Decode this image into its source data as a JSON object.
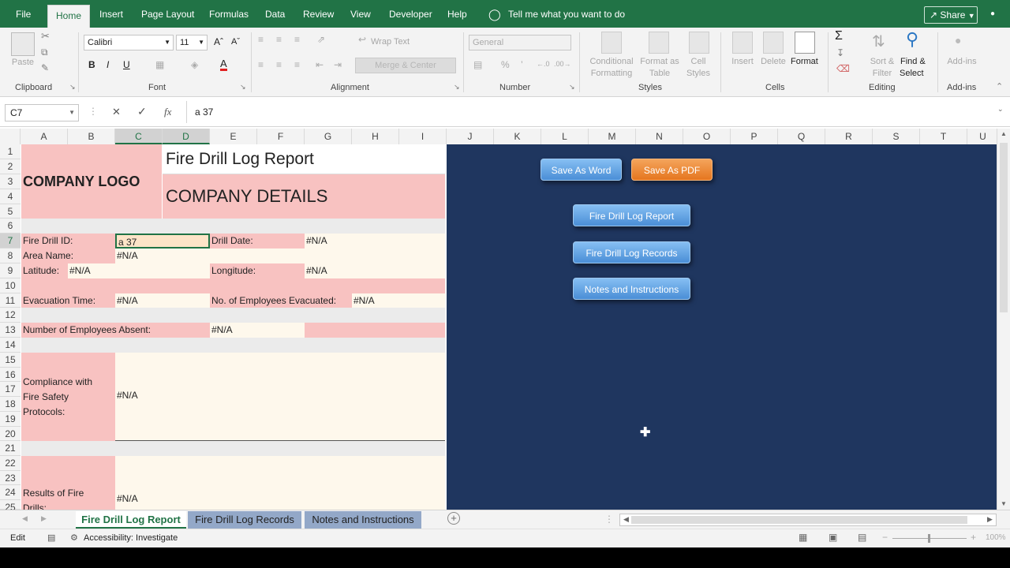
{
  "menu": {
    "tabs": [
      "File",
      "Home",
      "Insert",
      "Page Layout",
      "Formulas",
      "Data",
      "Review",
      "View",
      "Developer",
      "Help"
    ],
    "tell_me": "Tell me what you want to do",
    "share": "Share"
  },
  "ribbon": {
    "clipboard": {
      "paste": "Paste",
      "label": "Clipboard"
    },
    "font": {
      "name": "Calibri",
      "size": "11",
      "bold": "B",
      "italic": "I",
      "underline": "U",
      "label": "Font"
    },
    "alignment": {
      "wrap": "Wrap Text",
      "merge": "Merge & Center",
      "label": "Alignment"
    },
    "number": {
      "format": "General",
      "label": "Number"
    },
    "styles": {
      "conditional": [
        "Conditional",
        "Formatting"
      ],
      "format_table": [
        "Format as",
        "Table"
      ],
      "cell_styles": [
        "Cell",
        "Styles"
      ],
      "label": "Styles"
    },
    "cells": {
      "insert": "Insert",
      "delete": "Delete",
      "format": "Format",
      "label": "Cells"
    },
    "editing": {
      "sort": [
        "Sort &",
        "Filter"
      ],
      "find": [
        "Find &",
        "Select"
      ],
      "label": "Editing"
    },
    "addins": {
      "addins": "Add-ins",
      "label": "Add-ins"
    }
  },
  "formula_bar": {
    "name_box": "C7",
    "cancel": "✕",
    "enter": "✓",
    "fx": "fx",
    "formula": "a 37"
  },
  "columns": [
    "A",
    "B",
    "C",
    "D",
    "E",
    "F",
    "G",
    "H",
    "I",
    "J",
    "K",
    "L",
    "M",
    "N",
    "O",
    "P",
    "Q",
    "R",
    "S",
    "T",
    "U"
  ],
  "rows": [
    "1",
    "2",
    "3",
    "4",
    "5",
    "6",
    "7",
    "8",
    "9",
    "10",
    "11",
    "12",
    "13",
    "14",
    "15",
    "16",
    "17",
    "18",
    "19",
    "20",
    "21",
    "22",
    "23",
    "24",
    "25"
  ],
  "sheet": {
    "company_logo": "COMPANY LOGO",
    "report_title": "Fire Drill Log Report",
    "company_details": "COMPANY DETAILS",
    "fire_drill_id_label": "Fire Drill ID:",
    "fire_drill_id_value": "a 37",
    "drill_date_label": "Drill Date:",
    "drill_date_value": "#N/A",
    "area_name_label": "Area Name:",
    "area_name_value": "#N/A",
    "latitude_label": "Latitude:",
    "latitude_value": "#N/A",
    "longitude_label": "Longitude:",
    "longitude_value": "#N/A",
    "evac_time_label": "Evacuation Time:",
    "evac_time_value": "#N/A",
    "employees_evac_label": "No. of Employees Evacuated:",
    "employees_evac_value": "#N/A",
    "employees_absent_label": "Number of Employees Absent:",
    "employees_absent_value": "#N/A",
    "compliance_label": [
      "Compliance with",
      "Fire Safety",
      "Protocols:"
    ],
    "compliance_value": "#N/A",
    "results_label": [
      "Results of Fire",
      "Drills:"
    ],
    "results_value": "#N/A"
  },
  "buttons": {
    "save_word": "Save As Word",
    "save_pdf": "Save As PDF",
    "report": "Fire Drill Log Report",
    "records": "Fire Drill Log Records",
    "notes": "Notes and Instructions"
  },
  "sheet_tabs": [
    "Fire Drill Log Report",
    "Fire Drill Log Records",
    "Notes and Instructions"
  ],
  "status": {
    "mode": "Edit",
    "accessibility": "Accessibility: Investigate",
    "zoom": "100%"
  },
  "colors": {
    "excel_green": "#217346",
    "navy": "#1f365f",
    "pink": "#f8c2c1",
    "cream": "#fef8ec",
    "orange": "#e5761f",
    "blue": "#4a8ed6"
  }
}
